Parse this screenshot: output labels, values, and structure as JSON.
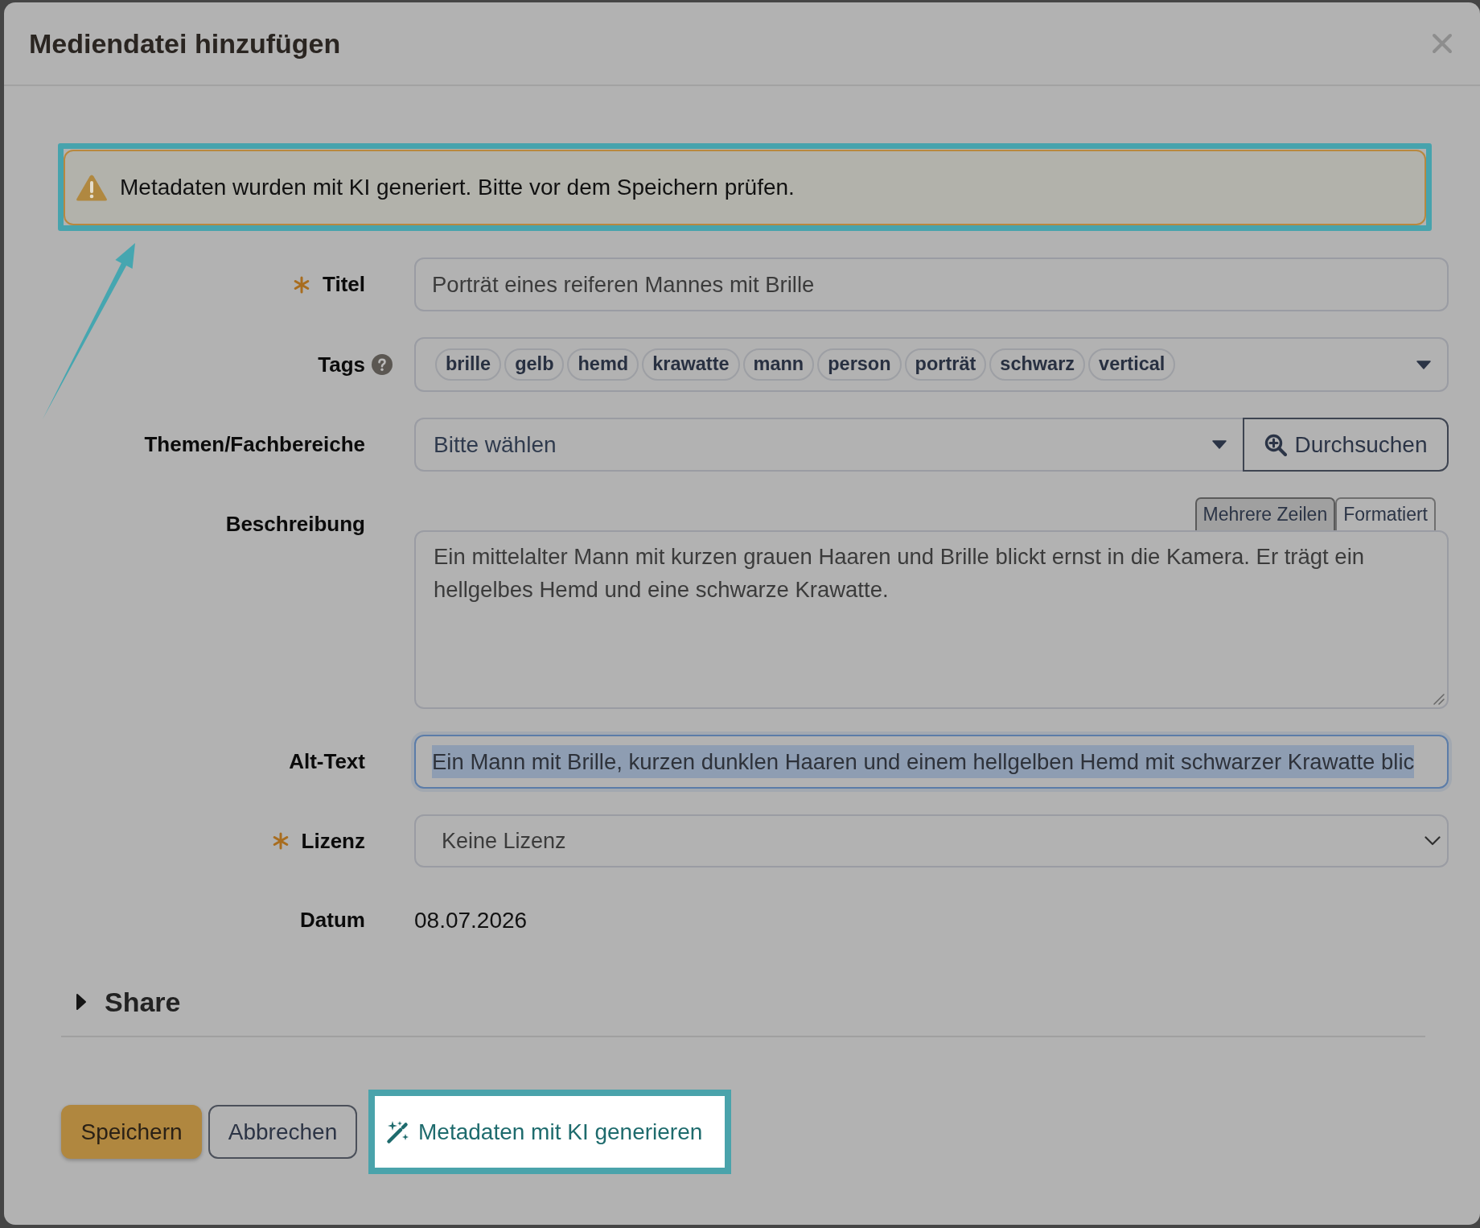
{
  "dialog": {
    "title": "Mediendatei hinzufügen"
  },
  "alert": {
    "text": "Metadaten wurden mit KI generiert. Bitte vor dem Speichern prüfen.",
    "highlighted": true
  },
  "fields": [
    {
      "kind": "text",
      "label": "Titel",
      "required": true,
      "help": false,
      "focused": false,
      "text_selected": false,
      "value": "Porträt eines reiferen Mannes mit Brille"
    },
    {
      "kind": "tags",
      "label": "Tags",
      "required": false,
      "help": true,
      "focused": false,
      "tags": [
        "brille",
        "gelb",
        "hemd",
        "krawatte",
        "mann",
        "person",
        "porträt",
        "schwarz",
        "vertical"
      ]
    },
    {
      "kind": "select_search",
      "label": "Themen/Fachbereiche",
      "required": false,
      "help": false,
      "focused": false,
      "placeholder": "Bitte wählen",
      "button": "Durchsuchen"
    },
    {
      "kind": "textarea",
      "label": "Beschreibung",
      "required": false,
      "help": false,
      "focused": false,
      "modes": [
        {
          "label": "Mehrere Zeilen",
          "selected": true
        },
        {
          "label": "Formatiert",
          "selected": false
        }
      ],
      "value": "Ein mittelalter Mann mit kurzen grauen Haaren und Brille blickt ernst in die Kamera. Er trägt ein hellgelbes Hemd und eine schwarze Krawatte."
    },
    {
      "kind": "text",
      "label": "Alt-Text",
      "required": false,
      "help": false,
      "focused": true,
      "text_selected": true,
      "value": "Ein Mann mit Brille, kurzen dunklen Haaren und einem hellgelben Hemd mit schwarzer Krawatte blic"
    },
    {
      "kind": "select",
      "label": "Lizenz",
      "required": true,
      "help": false,
      "focused": false,
      "value": "Keine Lizenz"
    },
    {
      "kind": "static",
      "label": "Datum",
      "required": false,
      "help": false,
      "focused": false,
      "value": "08.07.2026"
    }
  ],
  "share": {
    "label": "Share",
    "expanded": false
  },
  "buttons": [
    {
      "kind": "primary",
      "label": "Speichern",
      "highlighted": false
    },
    {
      "kind": "secondary",
      "label": "Abbrechen",
      "highlighted": false
    },
    {
      "kind": "ai",
      "label": "Metadaten mit KI generieren",
      "highlighted": true
    }
  ]
}
